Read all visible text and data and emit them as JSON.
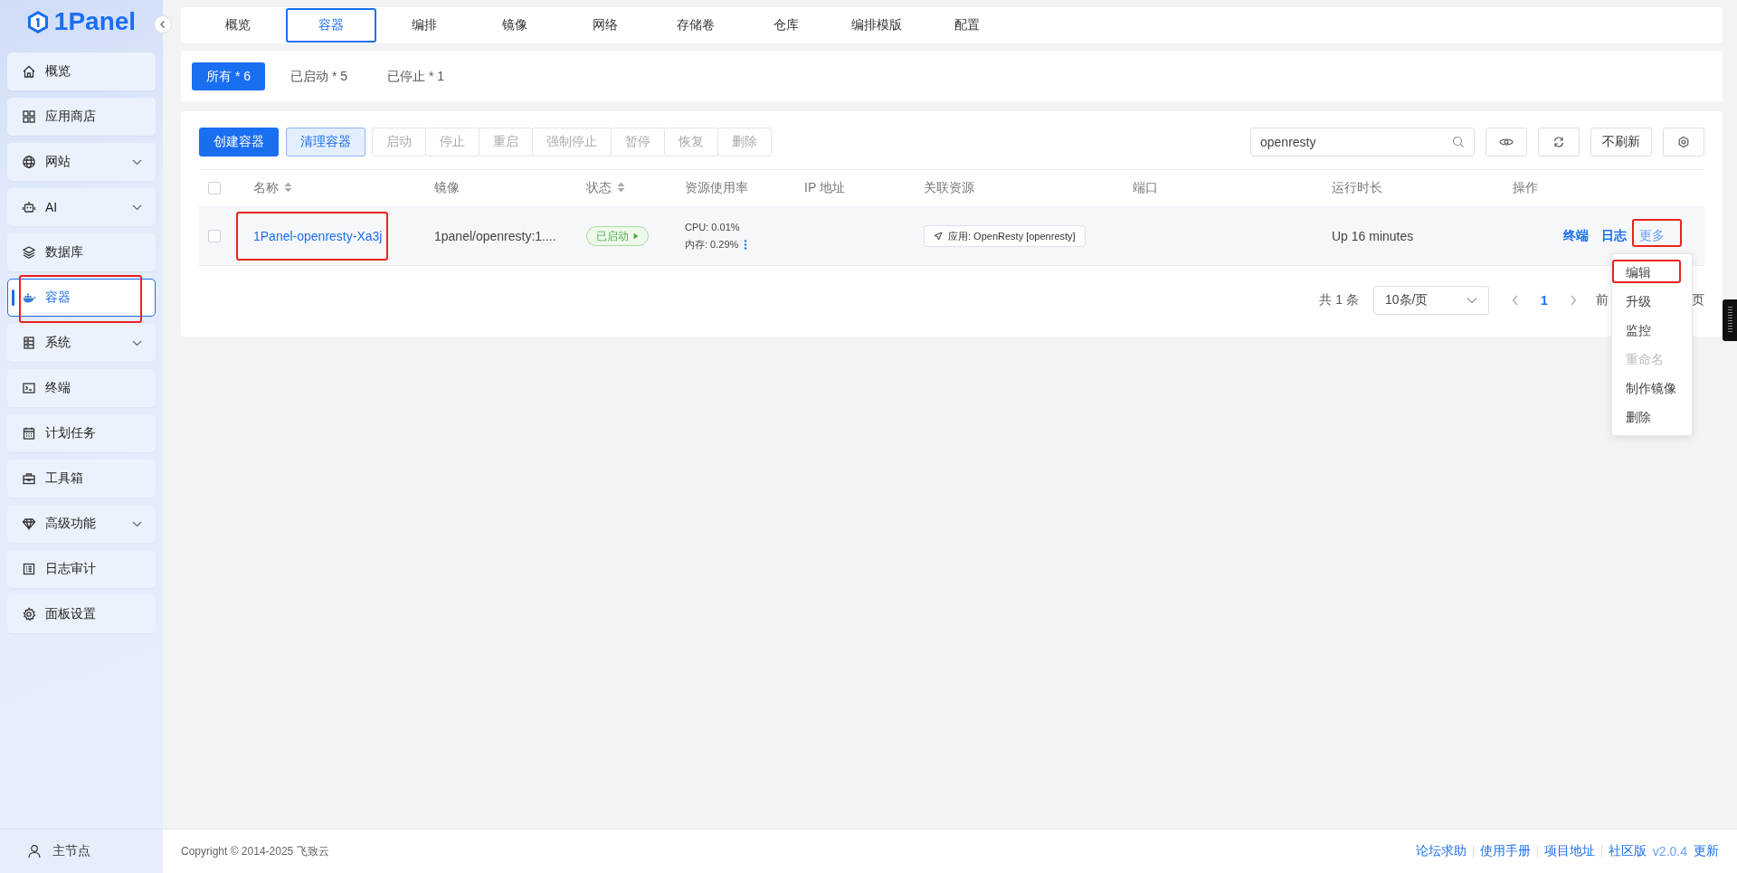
{
  "logo": {
    "text": "1Panel"
  },
  "sidebar": {
    "items": [
      {
        "label": "概览",
        "expandable": false,
        "selected": false,
        "annotated": false
      },
      {
        "label": "应用商店",
        "expandable": false,
        "selected": false,
        "annotated": false
      },
      {
        "label": "网站",
        "expandable": true,
        "selected": false,
        "annotated": false
      },
      {
        "label": "AI",
        "expandable": true,
        "selected": false,
        "annotated": false
      },
      {
        "label": "数据库",
        "expandable": false,
        "selected": false,
        "annotated": false
      },
      {
        "label": "容器",
        "expandable": false,
        "selected": true,
        "annotated": true
      },
      {
        "label": "系统",
        "expandable": true,
        "selected": false,
        "annotated": false
      },
      {
        "label": "终端",
        "expandable": false,
        "selected": false,
        "annotated": false
      },
      {
        "label": "计划任务",
        "expandable": false,
        "selected": false,
        "annotated": false
      },
      {
        "label": "工具箱",
        "expandable": false,
        "selected": false,
        "annotated": false
      },
      {
        "label": "高级功能",
        "expandable": true,
        "selected": false,
        "annotated": false
      },
      {
        "label": "日志审计",
        "expandable": false,
        "selected": false,
        "annotated": false
      },
      {
        "label": "面板设置",
        "expandable": false,
        "selected": false,
        "annotated": false
      }
    ],
    "node": "主节点"
  },
  "tabs": [
    {
      "label": "概览",
      "selected": false
    },
    {
      "label": "容器",
      "selected": true
    },
    {
      "label": "编排",
      "selected": false
    },
    {
      "label": "镜像",
      "selected": false
    },
    {
      "label": "网络",
      "selected": false
    },
    {
      "label": "存储卷",
      "selected": false
    },
    {
      "label": "仓库",
      "selected": false
    },
    {
      "label": "编排模版",
      "selected": false
    },
    {
      "label": "配置",
      "selected": false
    }
  ],
  "filters": [
    {
      "label": "所有 * 6",
      "selected": true
    },
    {
      "label": "已启动 * 5",
      "selected": false
    },
    {
      "label": "已停止 * 1",
      "selected": false
    }
  ],
  "toolbar": [
    {
      "label": "创建容器",
      "kind": "primary",
      "disabled": false
    },
    {
      "label": "清理容器",
      "kind": "light",
      "disabled": false
    },
    {
      "label": "启动",
      "kind": "group",
      "disabled": true
    },
    {
      "label": "停止",
      "kind": "group",
      "disabled": true
    },
    {
      "label": "重启",
      "kind": "group",
      "disabled": true
    },
    {
      "label": "强制停止",
      "kind": "group",
      "disabled": true
    },
    {
      "label": "暂停",
      "kind": "group",
      "disabled": true
    },
    {
      "label": "恢复",
      "kind": "group",
      "disabled": true
    },
    {
      "label": "删除",
      "kind": "group",
      "disabled": true
    }
  ],
  "search": {
    "value": "openresty"
  },
  "refresh_button": "不刷新",
  "table": {
    "all_checked": false,
    "columns": [
      {
        "label": "名称",
        "sortable": true
      },
      {
        "label": "镜像",
        "sortable": false
      },
      {
        "label": "状态",
        "sortable": true
      },
      {
        "label": "资源使用率",
        "sortable": false
      },
      {
        "label": "IP 地址",
        "sortable": false
      },
      {
        "label": "关联资源",
        "sortable": false
      },
      {
        "label": "端口",
        "sortable": false
      },
      {
        "label": "运行时长",
        "sortable": false
      },
      {
        "label": "操作",
        "sortable": false
      }
    ],
    "rows": [
      {
        "checked": false,
        "name": "1Panel-openresty-Xa3j",
        "annotated": true,
        "image": "1panel/openresty:1....",
        "status": "已启动",
        "cpu": "CPU: 0.01%",
        "memory": "内存: 0.29%",
        "related": "应用: OpenResty [openresty]",
        "uptime": "Up 16 minutes",
        "actions": [
          {
            "label": "终端",
            "annotated": false
          },
          {
            "label": "日志",
            "annotated": false
          },
          {
            "label": "更多",
            "annotated": true
          }
        ]
      }
    ]
  },
  "pagination": {
    "total": "共 1 条",
    "page_size": "10条/页",
    "pages": [
      {
        "label": "1",
        "selected": true
      }
    ],
    "jump_prefix": "前",
    "jump_suffix": "页"
  },
  "menu": {
    "items": [
      {
        "label": "编辑",
        "disabled": false,
        "annotated": true
      },
      {
        "label": "升级",
        "disabled": false,
        "annotated": false
      },
      {
        "label": "监控",
        "disabled": false,
        "annotated": false
      },
      {
        "label": "重命名",
        "disabled": true,
        "annotated": false
      },
      {
        "label": "制作镜像",
        "disabled": false,
        "annotated": false
      },
      {
        "label": "删除",
        "disabled": false,
        "annotated": false
      }
    ]
  },
  "footer": {
    "copyright": "Copyright © 2014-2025 飞致云",
    "links": [
      "论坛求助",
      "使用手册",
      "项目地址",
      "社区版"
    ],
    "version": "v2.0.4",
    "update": "更新"
  }
}
